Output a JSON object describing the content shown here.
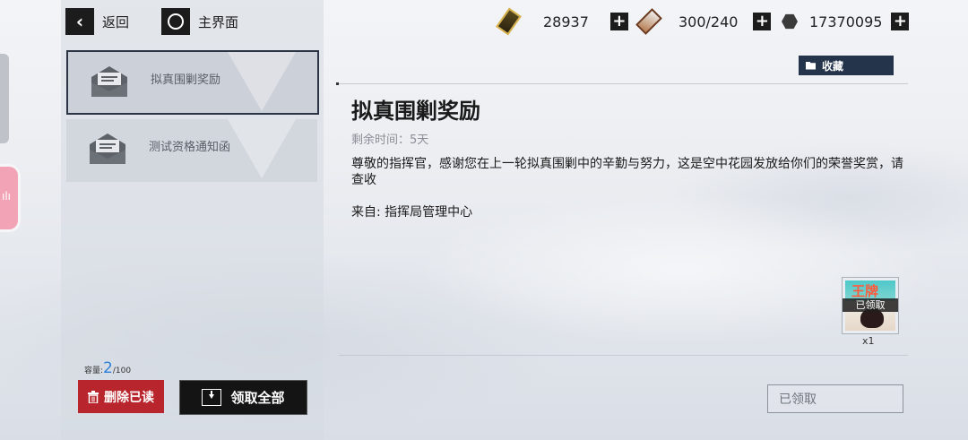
{
  "nav": {
    "back_label": "返回",
    "home_label": "主界面"
  },
  "resources": {
    "stamina": {
      "value": "28937",
      "icon": "stamina-battery-icon"
    },
    "cards": {
      "value": "300/240",
      "icon": "card-icon"
    },
    "coins": {
      "value": "17370095",
      "icon": "coin-icon"
    }
  },
  "mail_list": [
    {
      "title": "拟真围剿奖励",
      "selected": true
    },
    {
      "title": "测试资格通知函",
      "selected": false
    }
  ],
  "capacity": {
    "label": "容量:",
    "current": "2",
    "max": "/100"
  },
  "buttons": {
    "delete_read": "删除已读",
    "claim_all": "领取全部",
    "collect": "收藏",
    "claimed": "已领取"
  },
  "mail": {
    "title": "拟真围剿奖励",
    "remaining": "剩余时间：5天",
    "body": "尊敬的指挥官，感谢您在上一轮拟真围剿中的辛勤与努力，这是空中花园发放给你们的荣誉奖赏，请查收",
    "from": "来自: 指挥局管理中心"
  },
  "reward": {
    "art_text": "王牌",
    "claimed_tag": "已领取",
    "count": "x1"
  },
  "colors": {
    "delete_red": "#b8252c",
    "collect_navy": "#24344b",
    "capacity_blue": "#2e7fd6"
  }
}
